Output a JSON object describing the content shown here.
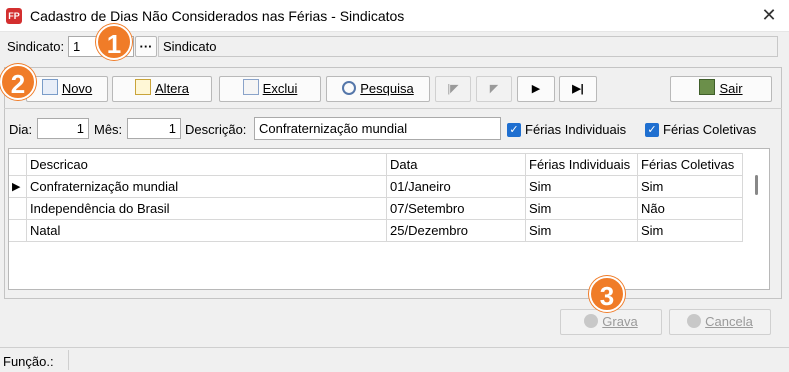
{
  "window": {
    "app_icon_label": "FP",
    "title": "Cadastro de Dias Não Considerados nas Férias - Sindicatos",
    "close": "✕"
  },
  "sindicato_bar": {
    "label": "Sindicato:",
    "value": "1",
    "lookup_button": "···",
    "name_value": "Sindicato"
  },
  "toolbar": {
    "novo": "Novo",
    "altera": "Altera",
    "exclui": "Exclui",
    "pesquisa": "Pesquisa",
    "first": "|◤",
    "prev": "◤",
    "next": "▶",
    "last": "▶|",
    "sair": "Sair"
  },
  "form": {
    "dia_label": "Dia:",
    "dia_value": "1",
    "mes_label": "Mês:",
    "mes_value": "1",
    "descricao_label": "Descrição:",
    "descricao_value": "Confraternização mundial",
    "ferias_individuais_label": "Férias Individuais",
    "ferias_individuais_checked": true,
    "ferias_coletivas_label": "Férias Coletivas",
    "ferias_coletivas_checked": true
  },
  "grid": {
    "columns": [
      "Descricao",
      "Data",
      "Férias Individuais",
      "Férias Coletivas"
    ],
    "rows": [
      [
        "Confraternização mundial",
        "01/Janeiro",
        "Sim",
        "Sim"
      ],
      [
        "Independência do Brasil",
        "07/Setembro",
        "Sim",
        "Não"
      ],
      [
        "Natal",
        "25/Dezembro",
        "Sim",
        "Sim"
      ]
    ],
    "current_row_marker": "▶"
  },
  "actions": {
    "grava": "Grava",
    "cancela": "Cancela"
  },
  "statusbar": {
    "funcao_label": "Função.:"
  },
  "callouts": [
    "1",
    "2",
    "3"
  ],
  "colors": {
    "callout": "#f07c28",
    "checkbox": "#1f6fd0",
    "app_icon": "#d32f2f"
  }
}
